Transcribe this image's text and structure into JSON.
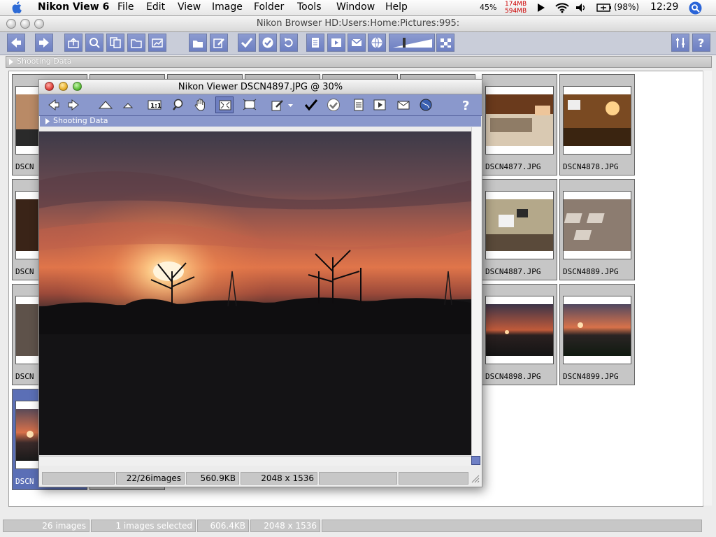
{
  "menubar": {
    "app": "Nikon View 6",
    "items": [
      "File",
      "Edit",
      "View",
      "Image",
      "Folder",
      "Tools",
      "Window",
      "Help"
    ],
    "cpu": "45%",
    "mem_top": "174MB",
    "mem_bottom": "594MB",
    "battery": "(98%)",
    "clock": "12:29"
  },
  "browser": {
    "title": "Nikon Browser HD:Users:Home:Pictures:995:",
    "shooting_data": "Shooting Data",
    "status": {
      "count": "26 images",
      "selected": "1 images selected",
      "size": "606.4KB",
      "dimensions": "2048 x 1536"
    },
    "visible_thumbs": [
      {
        "label": "DSCN4877.JPG"
      },
      {
        "label": "DSCN4878.JPG"
      },
      {
        "label": "DSCN4887.JPG"
      },
      {
        "label": "DSCN4889.JPG"
      },
      {
        "label": "DSCN4898.JPG"
      },
      {
        "label": "DSCN4899.JPG"
      }
    ],
    "partial_labels": [
      "DSCN",
      "DSCN",
      "DSCN",
      "DSCN"
    ]
  },
  "viewer": {
    "title": "Nikon Viewer DSCN4897.JPG @ 30%",
    "shooting_data": "Shooting Data",
    "status": {
      "images": "22/26images",
      "size": "560.9KB",
      "dimensions": "2048 x 1536"
    }
  },
  "colors": {
    "toolbar": "#8a98cc",
    "selection": "#5b6fb6",
    "close": "#e0443e",
    "minimize": "#e9b12b",
    "zoom": "#5fc03a"
  }
}
